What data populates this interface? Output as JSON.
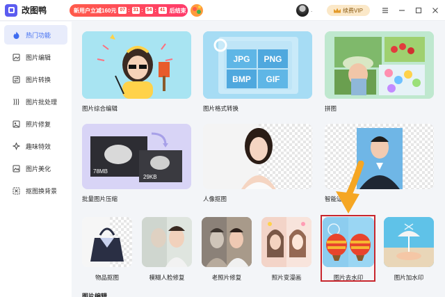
{
  "app": {
    "name": "改图鸭"
  },
  "promo": {
    "text": "新用户立减160元",
    "countdown": [
      "07",
      "31",
      "54",
      "41"
    ],
    "end_label": "后结束"
  },
  "user": {
    "name": "."
  },
  "vip": {
    "label": "续费VIP"
  },
  "sidebar": {
    "items": [
      {
        "label": "热门功能",
        "icon": "flame-icon",
        "active": true
      },
      {
        "label": "图片编辑",
        "icon": "image-edit-icon"
      },
      {
        "label": "图片转换",
        "icon": "convert-icon"
      },
      {
        "label": "图片批处理",
        "icon": "batch-icon"
      },
      {
        "label": "照片修复",
        "icon": "repair-icon"
      },
      {
        "label": "趣味特效",
        "icon": "sparkle-icon"
      },
      {
        "label": "图片美化",
        "icon": "beautify-icon"
      },
      {
        "label": "抠图换背景",
        "icon": "cutout-icon"
      }
    ]
  },
  "main": {
    "large_cards": [
      {
        "label": "图片综合编辑"
      },
      {
        "label": "图片格式转换",
        "formats": [
          "JPG",
          "PNG",
          "BMP",
          "GIF"
        ]
      },
      {
        "label": "拼图"
      },
      {
        "label": "批量图片压缩",
        "sizes": [
          "78MB",
          "29KB"
        ]
      },
      {
        "label": "人像抠图"
      },
      {
        "label": "智能证件照"
      }
    ],
    "small_cards": [
      {
        "label": "物品抠图"
      },
      {
        "label": "模糊人脸修复"
      },
      {
        "label": "老照片修复"
      },
      {
        "label": "照片变漫画"
      },
      {
        "label": "图片去水印"
      },
      {
        "label": "图片加水印"
      }
    ],
    "next_section_title": "图片编辑"
  },
  "colors": {
    "accent": "#3e6cf0",
    "highlight_box": "#c8262d",
    "arrow": "#f5a623"
  }
}
